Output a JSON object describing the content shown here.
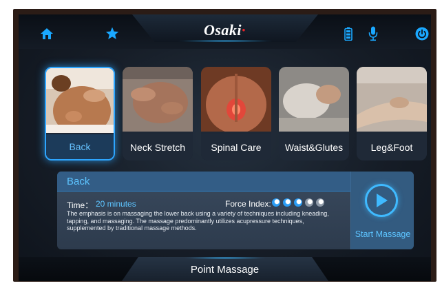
{
  "header": {
    "logo": "Osaki",
    "left_icons": [
      "home-icon",
      "favorite-star-icon"
    ],
    "right_icons": [
      "battery-icon",
      "microphone-icon",
      "power-icon"
    ],
    "accent_color": "#1aa8ff"
  },
  "programs": [
    {
      "label": "Back",
      "selected": true
    },
    {
      "label": "Neck Stretch",
      "selected": false
    },
    {
      "label": "Spinal Care",
      "selected": false
    },
    {
      "label": "Waist&Glutes",
      "selected": false
    },
    {
      "label": "Leg&Foot",
      "selected": false
    }
  ],
  "details": {
    "title": "Back",
    "time_label": "Time：",
    "time_value": "20 minutes",
    "force_label": "Force Index:",
    "force_level": 3,
    "force_max": 5,
    "description": "The emphasis is on massaging the lower back using a variety of techniques including kneading, tapping, and massaging. The massage predominantly utilizes acupressure techniques, supplemented by traditional massage methods.",
    "start_label": "Start Massage"
  },
  "footer": {
    "label": "Point Massage"
  }
}
